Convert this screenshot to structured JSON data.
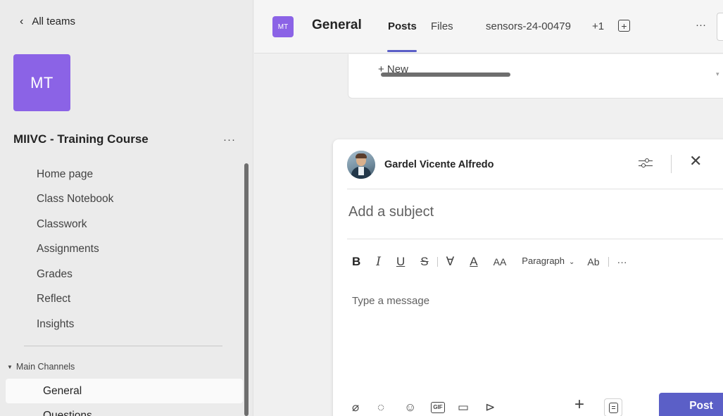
{
  "sidebar": {
    "back_label": "All teams",
    "team_initials": "MT",
    "team_name": "MIIVC - Training Course",
    "team_more": "···",
    "nav_items": [
      {
        "label": "Home page"
      },
      {
        "label": "Class Notebook"
      },
      {
        "label": "Classwork"
      },
      {
        "label": "Assignments"
      },
      {
        "label": "Grades"
      },
      {
        "label": "Reflect"
      },
      {
        "label": "Insights"
      }
    ],
    "section_title": "Main Channels",
    "channels": [
      {
        "label": "General",
        "active": true
      },
      {
        "label": "Questions",
        "active": false
      }
    ]
  },
  "header": {
    "avatar_initials": "MT",
    "channel_title": "General",
    "tabs": [
      {
        "label": "Posts",
        "active": true
      },
      {
        "label": "Files",
        "active": false
      },
      {
        "label": "sensors-24-00479",
        "active": false
      }
    ],
    "extra_tabs": "+1",
    "add_tab": "+",
    "more": "···"
  },
  "content": {
    "previous_card": {
      "new_label": "+ New"
    }
  },
  "compose": {
    "author_name": "Gardel Vicente Alfredo",
    "close": "✕",
    "subject_placeholder": "Add a subject",
    "toolbar": {
      "bold": "B",
      "italic": "I",
      "underline": "U",
      "strike": "S",
      "highlight": "∀",
      "font_color": "A",
      "font_size": "AA",
      "paragraph": "Paragraph",
      "paragraph_caret": "⌄",
      "clear_format": "Ab",
      "more": "···"
    },
    "message_placeholder": "Type a message",
    "bottom": {
      "attach_icon": "paperclip-icon",
      "loop_icon": "loop-icon",
      "emoji_icon": "emoji-icon",
      "gif": "GIF",
      "sticker_icon": "sticker-icon",
      "praise_icon": "praise-icon",
      "plus": "+",
      "post_label": "Post"
    }
  },
  "colors": {
    "accent": "#5b5fc7",
    "avatar": "#8b63e6",
    "sidebar_bg": "#ebebeb"
  }
}
